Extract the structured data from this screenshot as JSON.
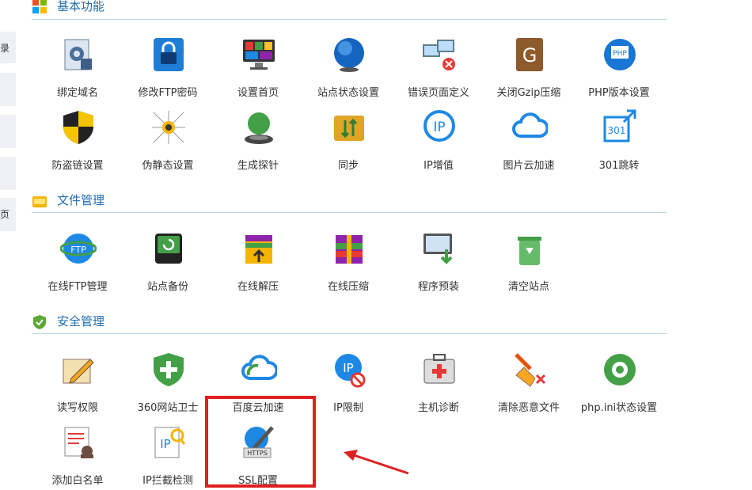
{
  "leftnav": {
    "items": [
      "录",
      "",
      "",
      "",
      "页"
    ]
  },
  "sections": {
    "basic": {
      "title": "基本功能"
    },
    "file": {
      "title": "文件管理"
    },
    "security": {
      "title": "安全管理"
    }
  },
  "basic": [
    {
      "label": "绑定域名",
      "icon": "gear-doc-icon"
    },
    {
      "label": "修改FTP密码",
      "icon": "lock-icon"
    },
    {
      "label": "设置首页",
      "icon": "monitor-icon"
    },
    {
      "label": "站点状态设置",
      "icon": "globe-icon"
    },
    {
      "label": "错误页面定义",
      "icon": "network-error-icon"
    },
    {
      "label": "关闭Gzip压缩",
      "icon": "gzip-icon"
    },
    {
      "label": "PHP版本设置",
      "icon": "php-icon"
    },
    {
      "label": "防盗链设置",
      "icon": "shield-icon"
    },
    {
      "label": "伪静态设置",
      "icon": "spider-icon"
    },
    {
      "label": "生成探针",
      "icon": "probe-icon"
    },
    {
      "label": "同步",
      "icon": "sync-folder-icon"
    },
    {
      "label": "IP增值",
      "icon": "ip-icon"
    },
    {
      "label": "图片云加速",
      "icon": "cloud-icon"
    },
    {
      "label": "301跳转",
      "icon": "redirect-icon"
    }
  ],
  "file": [
    {
      "label": "在线FTP管理",
      "icon": "ftp-globe-icon"
    },
    {
      "label": "站点备份",
      "icon": "backup-drive-icon"
    },
    {
      "label": "在线解压",
      "icon": "unzip-icon"
    },
    {
      "label": "在线压缩",
      "icon": "zip-icon"
    },
    {
      "label": "程序预装",
      "icon": "install-icon"
    },
    {
      "label": "清空站点",
      "icon": "recycle-bin-icon"
    }
  ],
  "security": [
    {
      "label": "读写权限",
      "icon": "edit-icon"
    },
    {
      "label": "360网站卫士",
      "icon": "guard-icon"
    },
    {
      "label": "百度云加速",
      "icon": "baidu-cloud-icon"
    },
    {
      "label": "IP限制",
      "icon": "ip-block-icon"
    },
    {
      "label": "主机诊断",
      "icon": "medkit-icon"
    },
    {
      "label": "清除恶意文件",
      "icon": "broom-icon"
    },
    {
      "label": "php.ini状态设置",
      "icon": "settings-icon"
    },
    {
      "label": "添加白名单",
      "icon": "whitelist-icon"
    },
    {
      "label": "IP拦截检测",
      "icon": "ip-search-icon"
    },
    {
      "label": "SSL配置",
      "icon": "https-icon"
    }
  ],
  "colors": {
    "accent": "#1f6fb2",
    "divider": "#b9d7ea",
    "highlight": "#e02020"
  }
}
